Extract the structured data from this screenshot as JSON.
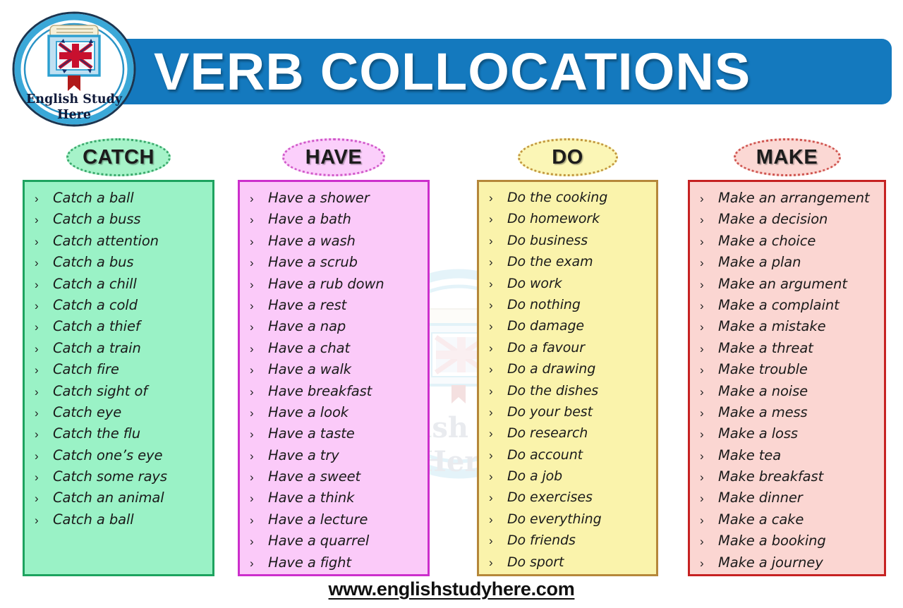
{
  "logo": {
    "line1": "English Study",
    "line2": "Here",
    "ring_color": "#3aa8d8",
    "book_color": "#2b9fd0",
    "ribbon_color": "#b01a1a",
    "text_color": "#101a3a",
    "icon": "book-union-jack-logo"
  },
  "header": {
    "title": "VERB COLLOCATIONS",
    "banner_color": "#1479be",
    "title_color": "#ffffff"
  },
  "watermark": {
    "line1": "English Study",
    "line2": "Here"
  },
  "columns": [
    {
      "id": "catch",
      "label": "CATCH",
      "fill": "#9af2c6",
      "border": "#1da35f",
      "bullet": "›",
      "items": [
        "Catch a ball",
        "Catch a buss",
        "Catch attention",
        "Catch a bus",
        "Catch a chill",
        "Catch a cold",
        "Catch a thief",
        "Catch a train",
        "Catch fire",
        "Catch sight of",
        "Catch eye",
        "Catch the flu",
        "Catch one’s eye",
        "Catch some rays",
        "Catch an animal",
        "Catch a ball"
      ]
    },
    {
      "id": "have",
      "label": "HAVE",
      "fill": "#fbcaf9",
      "border": "#cc2fcc",
      "bullet": "›",
      "items": [
        "Have a shower",
        "Have a bath",
        "Have a wash",
        "Have a scrub",
        "Have a rub down",
        "Have a rest",
        "Have a nap",
        "Have a chat",
        "Have a walk",
        "Have breakfast",
        "Have a look",
        "Have a taste",
        "Have a try",
        "Have a sweet",
        "Have a think",
        "Have a lecture",
        "Have a quarrel",
        "Have a fight"
      ]
    },
    {
      "id": "do",
      "label": "DO",
      "fill": "#faf3ab",
      "border": "#b5873a",
      "bullet": "›",
      "items": [
        "Do the cooking",
        "Do homework",
        "Do business",
        "Do the exam",
        "Do work",
        "Do nothing",
        "Do damage",
        "Do a favour",
        "Do a drawing",
        "Do the dishes",
        "Do your best",
        "Do research",
        "Do account",
        "Do a job",
        "Do exercises",
        "Do everything",
        "Do friends",
        "Do sport"
      ]
    },
    {
      "id": "make",
      "label": "MAKE",
      "fill": "#fbd6d2",
      "border": "#c62222",
      "bullet": "›",
      "items": [
        "Make an arrangement",
        "Make a decision",
        "Make a choice",
        "Make a plan",
        "Make an argument",
        "Make a complaint",
        "Make a mistake",
        "Make a threat",
        "Make trouble",
        "Make a noise",
        "Make a mess",
        "Make a loss",
        "Make tea",
        "Make breakfast",
        "Make dinner",
        "Make a cake",
        "Make a booking",
        "Make a journey"
      ]
    }
  ],
  "footer": {
    "url": "www.englishstudyhere.com"
  }
}
